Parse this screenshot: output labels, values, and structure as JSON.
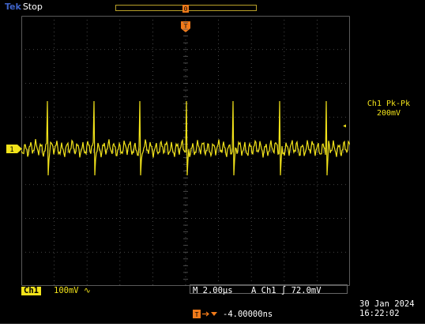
{
  "header": {
    "brand": "Tek",
    "acq_state": "Stop"
  },
  "channel": {
    "marker": "1",
    "badge": "Ch1",
    "scale": "100mV",
    "coupling_symbol": "∿",
    "color": "#f2e31a"
  },
  "measurement": {
    "label": "Ch1 Pk-Pk",
    "value": "200mV"
  },
  "horizontal": {
    "timebase": "M 2.00µs",
    "trigger_label": "A",
    "trigger_source": "Ch1",
    "trigger_slope": "∫",
    "trigger_level": "72.0mV",
    "offset": "-4.00000ns"
  },
  "timestamp": {
    "date": "30 Jan  2024",
    "time": "16:22:02"
  },
  "colors": {
    "background": "#000000",
    "trace": "#f2e31a",
    "grid": "#5a5a5a",
    "accent": "#f07a1a",
    "brand": "#3f63c9"
  }
}
